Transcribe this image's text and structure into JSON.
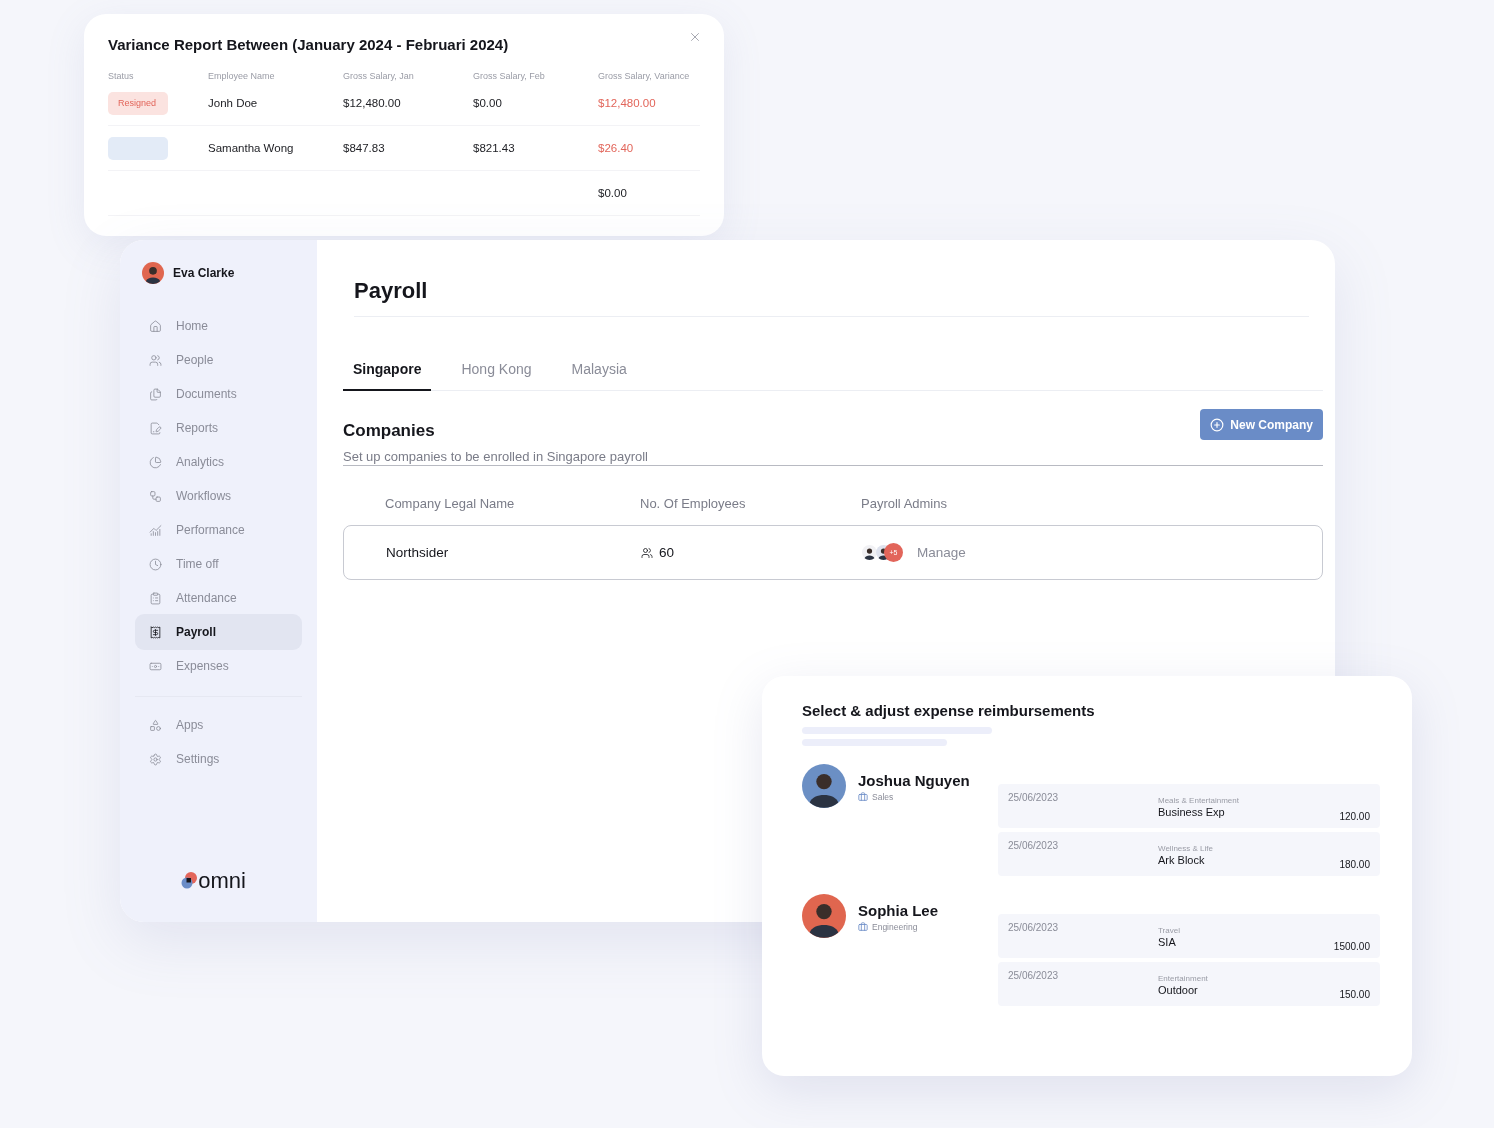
{
  "variance_report": {
    "title": "Variance Report Between (January 2024 - Februari 2024)",
    "columns": [
      "Status",
      "Employee Name",
      "Gross Salary, Jan",
      "Gross Salary, Feb",
      "Gross Salary, Variance"
    ],
    "rows": [
      {
        "status": "Resigned",
        "color": "#fbe3e0",
        "name": "Jonh Doe",
        "jan": "$12,480.00",
        "feb": "$0.00",
        "variance": "$12,480.00",
        "flagged": true
      },
      {
        "color": "#e3ebf7",
        "name": "Samantha Wong",
        "jan": "$847.83",
        "feb": "$821.43",
        "variance": "$26.40",
        "flagged": true
      },
      {
        "variance": "$0.00",
        "flagged": false
      }
    ]
  },
  "sidebar": {
    "user": "Eva Clarke",
    "items": [
      {
        "label": "Home",
        "selected": false
      },
      {
        "label": "People",
        "selected": false
      },
      {
        "label": "Documents",
        "selected": false
      },
      {
        "label": "Reports",
        "selected": false
      },
      {
        "label": "Analytics",
        "selected": false
      },
      {
        "label": "Workflows",
        "selected": false
      },
      {
        "label": "Performance",
        "selected": false
      },
      {
        "label": "Time off",
        "selected": false
      },
      {
        "label": "Attendance",
        "selected": false
      },
      {
        "label": "Payroll",
        "selected": true
      },
      {
        "label": "Expenses",
        "selected": false
      }
    ],
    "bottom_items": [
      {
        "label": "Apps",
        "selected": false
      },
      {
        "label": "Settings",
        "selected": false
      }
    ],
    "logo": "omni"
  },
  "page": {
    "title": "Payroll",
    "tabs": [
      {
        "label": "Singapore",
        "selected": true
      },
      {
        "label": "Hong Kong",
        "selected": false
      },
      {
        "label": "Malaysia",
        "selected": false
      }
    ],
    "section_title": "Companies",
    "section_subtitle": "Set up companies to be enrolled in Singapore payroll",
    "new_button": "New Company",
    "table": {
      "columns": [
        "Company Legal Name",
        "No. Of Employees",
        "Payroll Admins"
      ],
      "rows": [
        {
          "company": "Northsider",
          "employees": "60",
          "admins_more": "+5",
          "action": "Manage"
        }
      ]
    }
  },
  "expense_card": {
    "title": "Select & adjust expense reimbursements",
    "employees": [
      {
        "name": "Joshua Nguyen",
        "department": "Sales",
        "expenses": [
          {
            "date": "25/06/2023",
            "category": "Meals & Entertainment",
            "name": "Business Exp",
            "amount": "120.00"
          },
          {
            "date": "25/06/2023",
            "category": "Wellness & Life",
            "name": "Ark Block",
            "amount": "180.00"
          }
        ]
      },
      {
        "name": "Sophia Lee",
        "department": "Engineering",
        "expenses": [
          {
            "date": "25/06/2023",
            "category": "Travel",
            "name": "SIA",
            "amount": "1500.00"
          },
          {
            "date": "25/06/2023",
            "category": "Entertainment",
            "name": "Outdoor",
            "amount": "150.00"
          }
        ]
      }
    ]
  }
}
